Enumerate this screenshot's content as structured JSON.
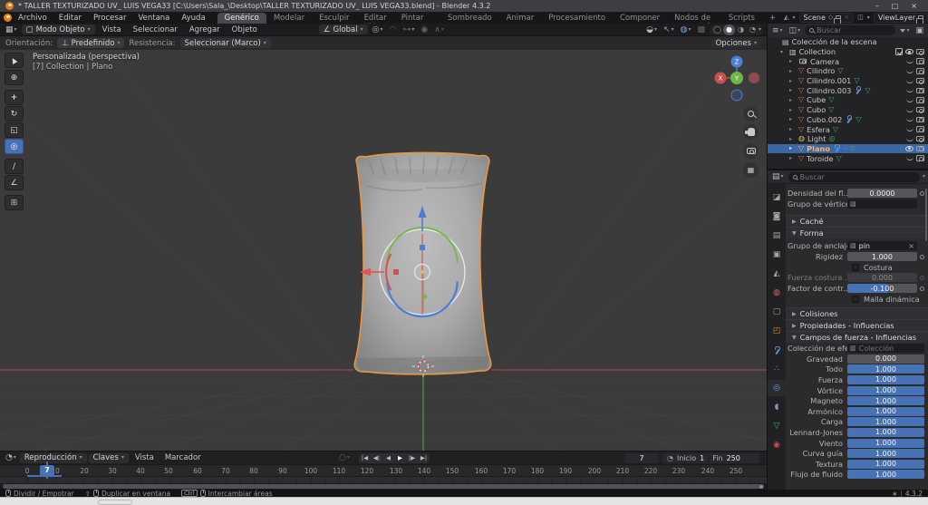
{
  "window": {
    "title": "* TALLER TEXTURIZADO UV_ LUIS VEGA33 [C:\\Users\\Sala_\\Desktop\\TALLER TEXTURIZADO UV_ LUIS VEGA33.blend] - Blender 4.3.2",
    "minimize": "–",
    "maximize": "□",
    "close": "×"
  },
  "topbar": {
    "menus": [
      "Archivo",
      "Editar",
      "Procesar",
      "Ventana",
      "Ayuda"
    ],
    "tabs": [
      "Genérico",
      "Modelar",
      "Esculpir",
      "Editar UV",
      "Pintar texturas",
      "Sombreado",
      "Animar",
      "Procesamiento",
      "Componer",
      "Nodos de geometría",
      "Scripts",
      "+"
    ],
    "scene_name": "Scene",
    "view_layer_name": "ViewLayer"
  },
  "viewport_header": {
    "mode": "Modo Objeto",
    "menus": [
      "Vista",
      "Seleccionar",
      "Agregar",
      "Objeto"
    ],
    "orientation": "Global",
    "options": "Opciones"
  },
  "tool_settings": {
    "orientation_label": "Orientación:",
    "orientation_value": "Predefinido",
    "fallback_label": "Resistencia:",
    "fallback_value": "Seleccionar (Marco)"
  },
  "viewport": {
    "view_label": "Personalizada (perspectiva)",
    "breadcrumb": "[7] Collection | Plano",
    "axis_x": "X",
    "axis_y": "Y",
    "axis_z": "Z"
  },
  "outliner": {
    "search_placeholder": "Buscar",
    "root_label": "Colección de la escena",
    "collection_label": "Collection",
    "items": [
      "Camera",
      "Cilindro",
      "Cilindro.001",
      "Cilindro.003",
      "Cube",
      "Cubo",
      "Cubo.002",
      "Esfera",
      "Light",
      "Plano",
      "Toroide"
    ]
  },
  "properties": {
    "search_placeholder": "Buscar",
    "density_label": "Densidad del fl...",
    "density_value": "0.0000",
    "vertex_group_label": "Grupo de vértices",
    "cache_panel": "Caché",
    "shape_panel": "Forma",
    "pin_group_label": "Grupo de anclaje",
    "pin_group_value": "pin",
    "pin_clear": "×",
    "stiffness_label": "Rigidez",
    "stiffness_value": "1.000",
    "sewing_label": "Costura",
    "sewing_force_label": "Fuerza costura ...",
    "sewing_force_value": "0.000",
    "shrink_label": "Factor de contr...",
    "shrink_value": "-0.100",
    "dynamic_mesh_label": "Malla dinámica",
    "collisions_panel": "Colisiones",
    "weights_panel": "Propiedades - Influencias",
    "force_fields_panel": "Campos de fuerza - Influencias",
    "effector_label": "Colección de efe...",
    "effector_placeholder": "Colección",
    "force_rows": [
      {
        "label": "Gravedad",
        "value": "0.000"
      },
      {
        "label": "Todo",
        "value": "1.000"
      },
      {
        "label": "Fuerza",
        "value": "1.000"
      },
      {
        "label": "Vórtice",
        "value": "1.000"
      },
      {
        "label": "Magneto",
        "value": "1.000"
      },
      {
        "label": "Armónico",
        "value": "1.000"
      },
      {
        "label": "Carga",
        "value": "1.000"
      },
      {
        "label": "Lennard-Jones",
        "value": "1.000"
      },
      {
        "label": "Viento",
        "value": "1.000"
      },
      {
        "label": "Curva guía",
        "value": "1.000"
      },
      {
        "label": "Textura",
        "value": "1.000"
      },
      {
        "label": "Flujo de fluido",
        "value": "1.000"
      }
    ]
  },
  "timeline": {
    "playback_menu": "Reproducción",
    "keys_menu": "Claves",
    "view_menu": "Vista",
    "marker_menu": "Marcador",
    "current_frame": "7",
    "start_label": "Inicio",
    "start_value": "1",
    "end_label": "Fin",
    "end_value": "250",
    "ticks": [
      "0",
      "10",
      "20",
      "30",
      "40",
      "50",
      "60",
      "70",
      "80",
      "90",
      "100",
      "110",
      "120",
      "130",
      "140",
      "150",
      "160",
      "170",
      "180",
      "190",
      "200",
      "210",
      "220",
      "230",
      "240",
      "250"
    ]
  },
  "status_bar": {
    "split_label": "Dividir / Empotrar",
    "duplicate_label": "Duplicar en ventana",
    "ctrl_key": "Ctrl",
    "swap_label": "Intercambiar áreas",
    "version": "4.3.2"
  },
  "colors": {
    "accent": "#4772b3",
    "selection_orange": "#e87d0d",
    "object_outline": "#f1953d"
  }
}
